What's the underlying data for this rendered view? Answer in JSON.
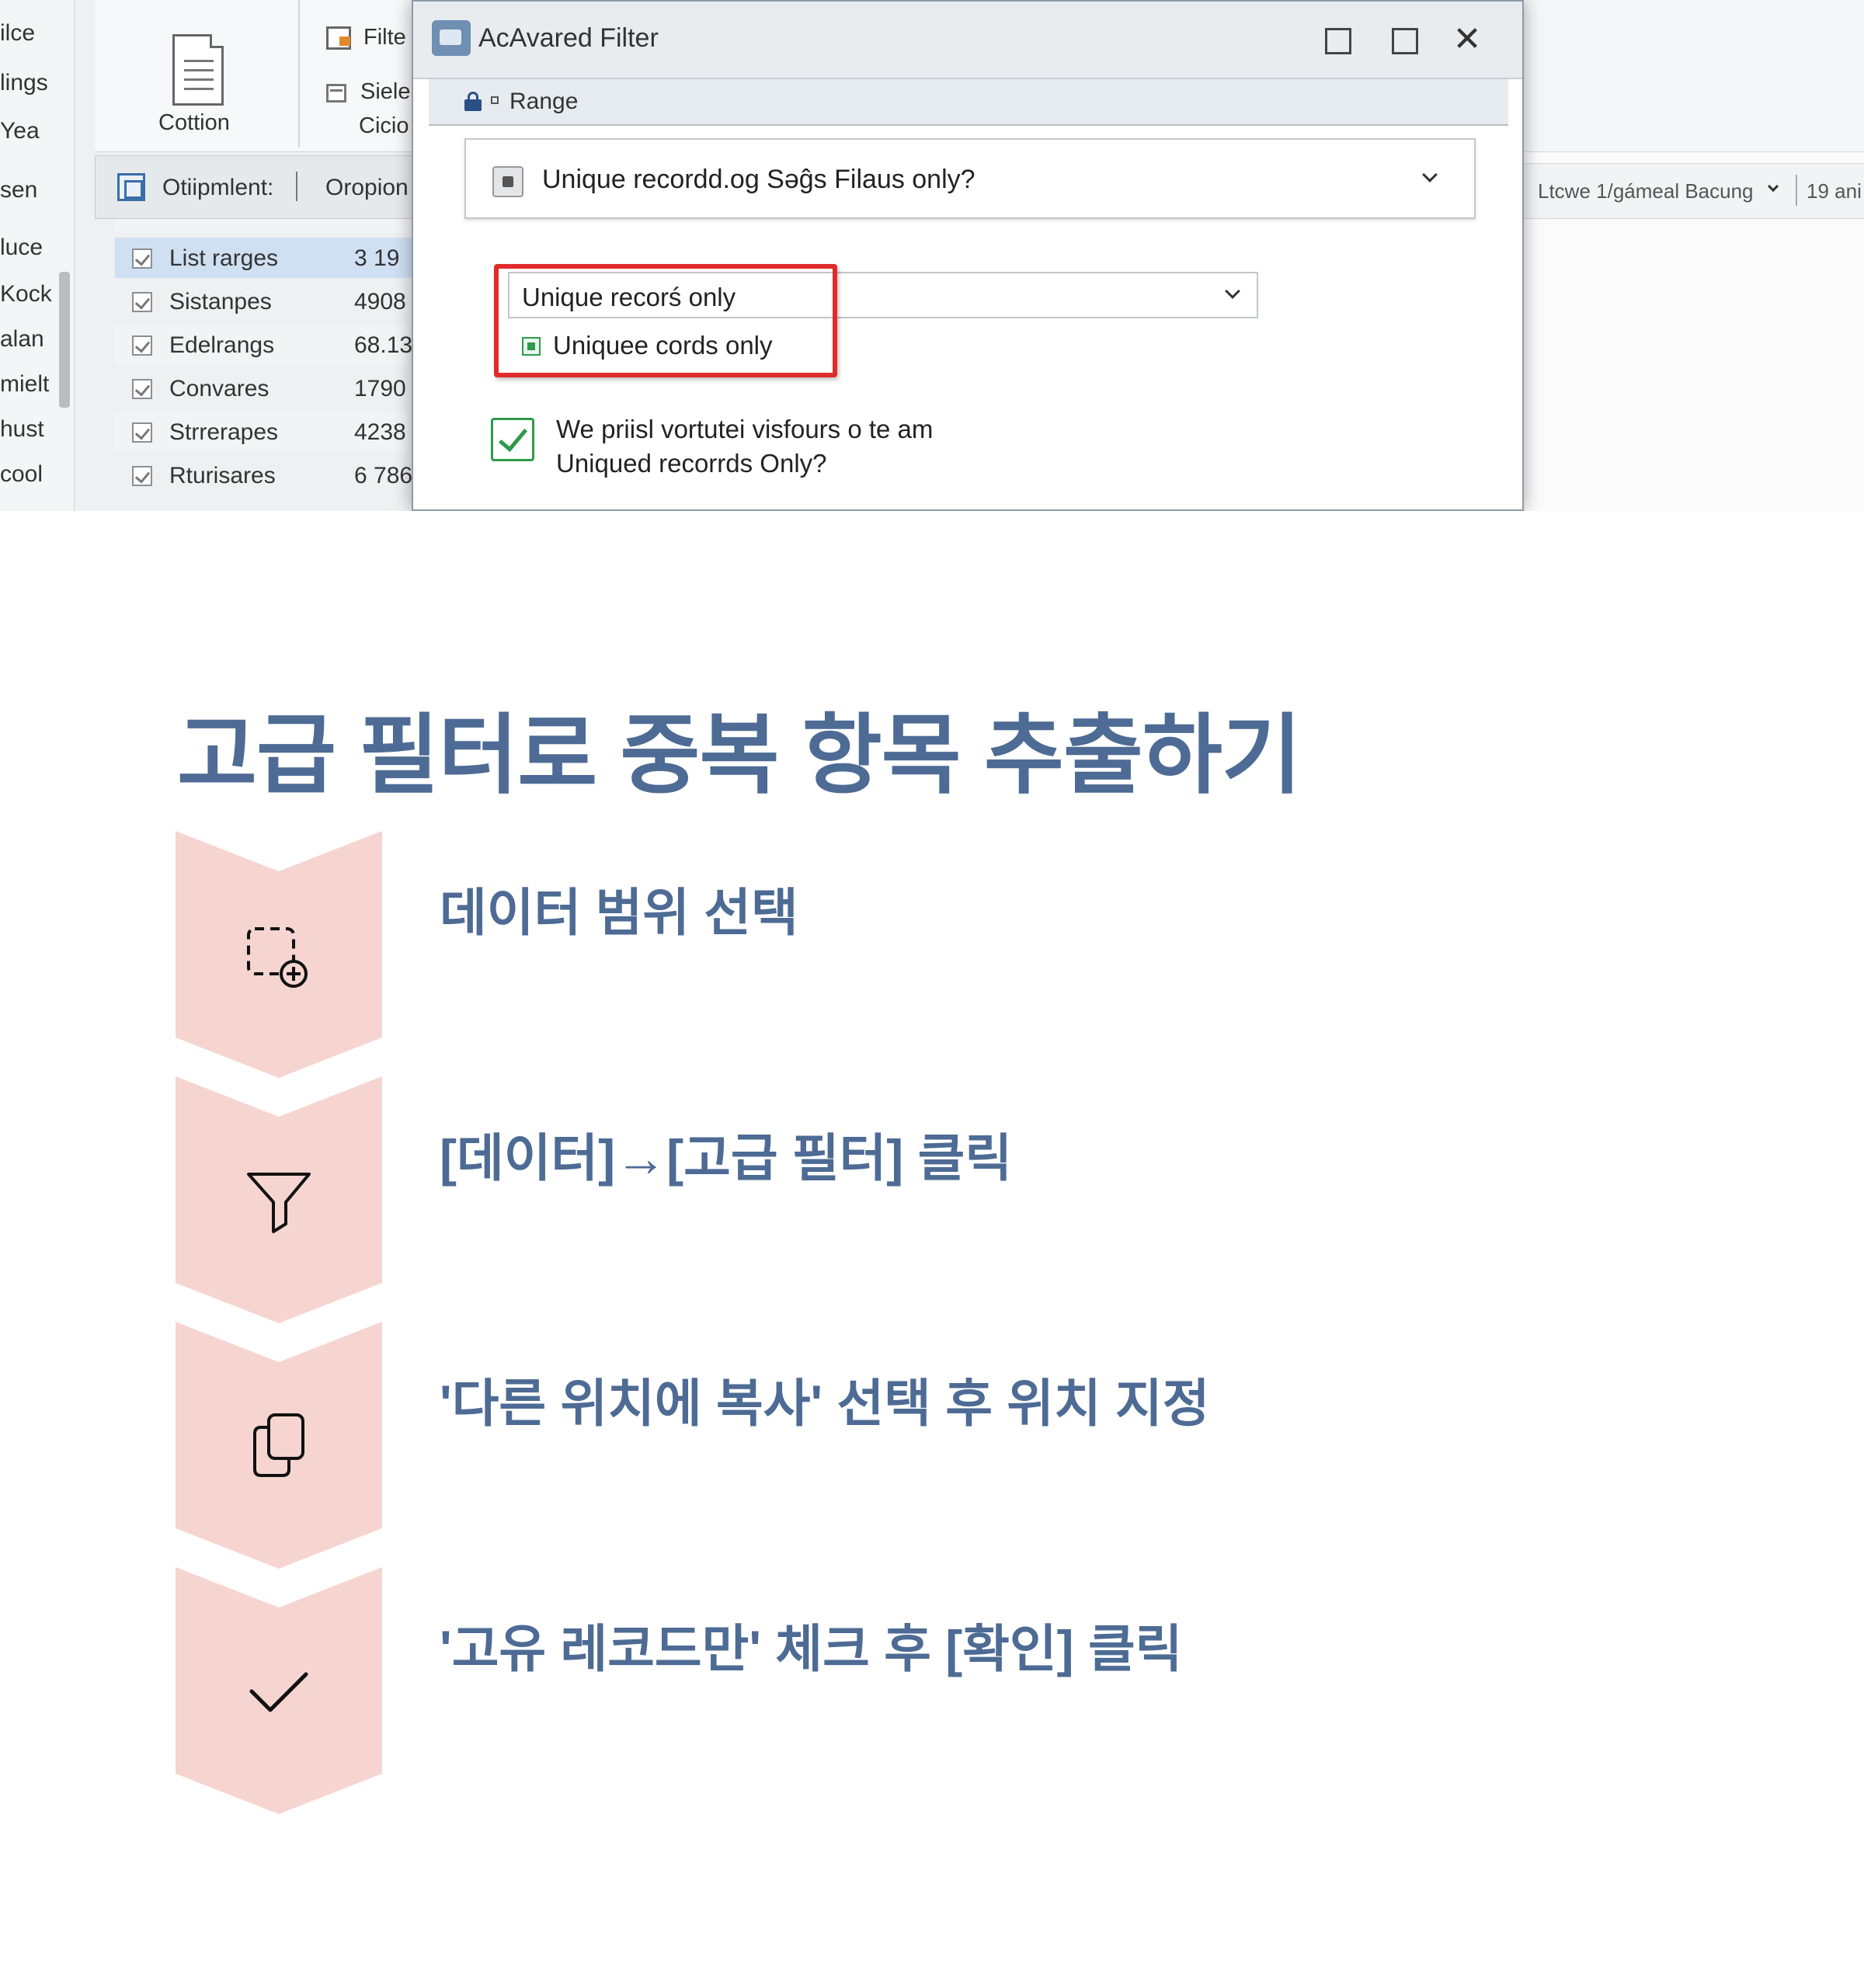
{
  "screenshot": {
    "nav_items": [
      "ilce",
      "lings",
      "Yea",
      "sen",
      "luce",
      "Kock",
      "alan",
      "mielt",
      "hust",
      "cool"
    ],
    "ribbon": {
      "big_button_label": "Cottion",
      "filter_label": "Filte",
      "select_label": "Siele",
      "clear_label": "Cicio"
    },
    "optbar": {
      "label": "Otiipmlent:",
      "option": "Oropion"
    },
    "list_rows": [
      {
        "label": "List rarges",
        "value": "3 19"
      },
      {
        "label": "Sistanpes",
        "value": "4908"
      },
      {
        "label": "Edelrangs",
        "value": "68.13"
      },
      {
        "label": "Convares",
        "value": "1790"
      },
      {
        "label": "Strrerapes",
        "value": "4238"
      },
      {
        "label": "Rturisares",
        "value": "6 786"
      }
    ],
    "right_pane": {
      "dropdown_text": "Ltcwe 1/gámeal Bacung",
      "count_text": "19 ani"
    },
    "dialog": {
      "title": "AcAvared Filter",
      "section_label": "Range",
      "combo_main": "Unique recordd.og Səĝs Filaus only?",
      "combo_sub": "Unique recorś only",
      "option_highlighted": "Uniquee cords only",
      "checkbox_line1": "We priisl vortutei visfours o te am",
      "checkbox_line2": "Uniqued recorrds Only?"
    }
  },
  "slide": {
    "title": "고급 필터로 중복 항목 추출하기",
    "steps": [
      {
        "icon": "select-area-add-icon",
        "text": "데이터 범위 선택"
      },
      {
        "icon": "filter-funnel-icon",
        "text": "[데이터]→[고급 필터] 클릭"
      },
      {
        "icon": "copy-icon",
        "text": "'다른 위치에 복사' 선택 후 위치 지정"
      },
      {
        "icon": "checkmark-icon",
        "text": "'고유 레코드만' 체크 후 [확인] 클릭"
      }
    ],
    "colors": {
      "title": "#4d6b94",
      "chevron_fill": "#f6d5d0",
      "highlight_box": "#e02b2b",
      "check_green": "#2e9a4a"
    }
  }
}
